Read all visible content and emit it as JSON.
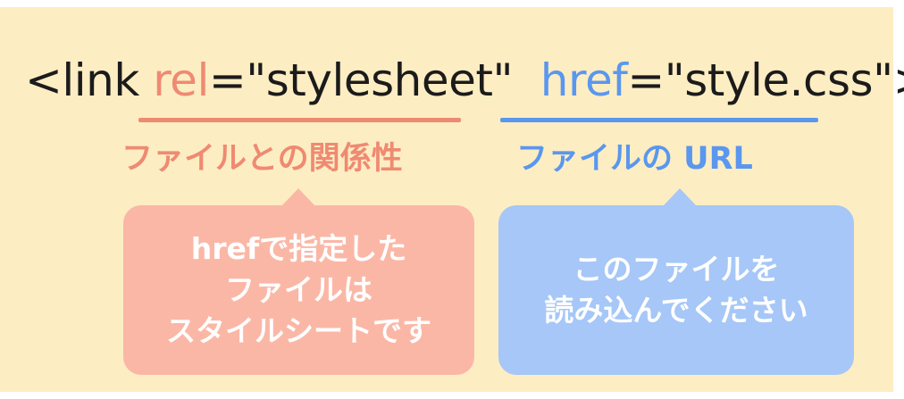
{
  "code": {
    "open": "<link ",
    "rel_attr": "rel",
    "rel_value": "=\"stylesheet\"",
    "gap": "  ",
    "href_attr": "href",
    "href_value": "=\"style.css\">"
  },
  "rel_caption": "ファイルとの関係性",
  "href_caption": "ファイルの URL",
  "rel_bubble": {
    "lines": [
      "hrefで指定した",
      "ファイルは",
      "スタイルシートです"
    ]
  },
  "href_bubble": {
    "lines": [
      "このファイルを",
      "読み込んでください"
    ]
  },
  "colors": {
    "background": "#fdedc3",
    "rel_accent": "#ef8a72",
    "href_accent": "#5a97ee",
    "rel_bubble": "#fbb7a6",
    "href_bubble": "#a6c7f7"
  }
}
